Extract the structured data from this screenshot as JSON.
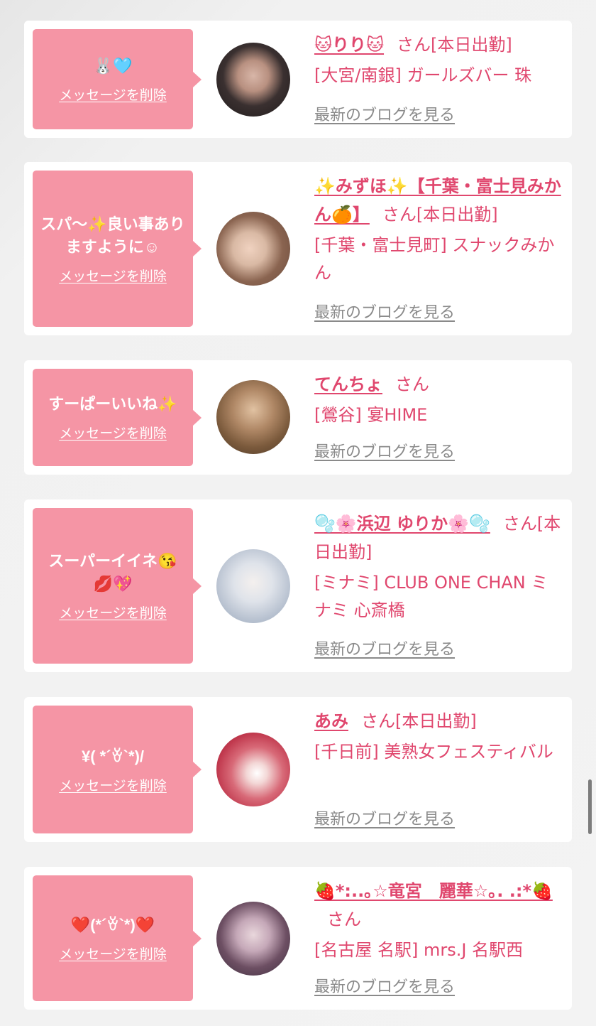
{
  "common": {
    "delete_label": "メッセージを削除",
    "blog_label": "最新のブログを見る"
  },
  "cards": [
    {
      "message": "🐰🩵",
      "name": "🐱りり🐱",
      "honorific": "さん[本日出勤]",
      "shop": "[大宮/南銀] ガールズバー 珠",
      "avatar_colors": [
        "#3a3030",
        "#d8b6a8"
      ]
    },
    {
      "message": "スパ〜✨良い事ありますように☺",
      "name": "✨みずほ✨【千葉・富士見みかん🍊】",
      "honorific": "さん[本日出勤]",
      "shop": "[千葉・富士見町] スナックみかん",
      "avatar_colors": [
        "#d9b9a4",
        "#6a4b3c"
      ]
    },
    {
      "message": "すーぱーいいね✨",
      "name": "てんちょ",
      "honorific": "さん",
      "shop": "[鶯谷] 宴HIME",
      "avatar_colors": [
        "#7b5a3c",
        "#e1c2a2"
      ]
    },
    {
      "message": "スーパーイイネ😘💋💖",
      "name": "🫧🌸浜辺 ゆりか🌸🫧",
      "honorific": "さん[本日出勤]",
      "shop": "[ミナミ] CLUB ONE CHAN ミナミ 心斎橋",
      "avatar_colors": [
        "#dfe3ea",
        "#b6c0cf"
      ]
    },
    {
      "message": "¥( *´ꈊ`*)/",
      "name": "あみ",
      "honorific": "さん[本日出勤]",
      "shop": "[千日前] 美熟女フェスティバル",
      "avatar_colors": [
        "#c0384d",
        "#f3d7d6"
      ]
    },
    {
      "message": "❤️(*´ꈊ`*)❤️",
      "name": "🍓*:..｡☆竜宮　麗華☆｡. .:*🍓",
      "honorific": "さん",
      "shop": "[名古屋 名駅] mrs.J 名駅西",
      "avatar_colors": [
        "#3b2c3c",
        "#c5a8b8"
      ]
    }
  ]
}
